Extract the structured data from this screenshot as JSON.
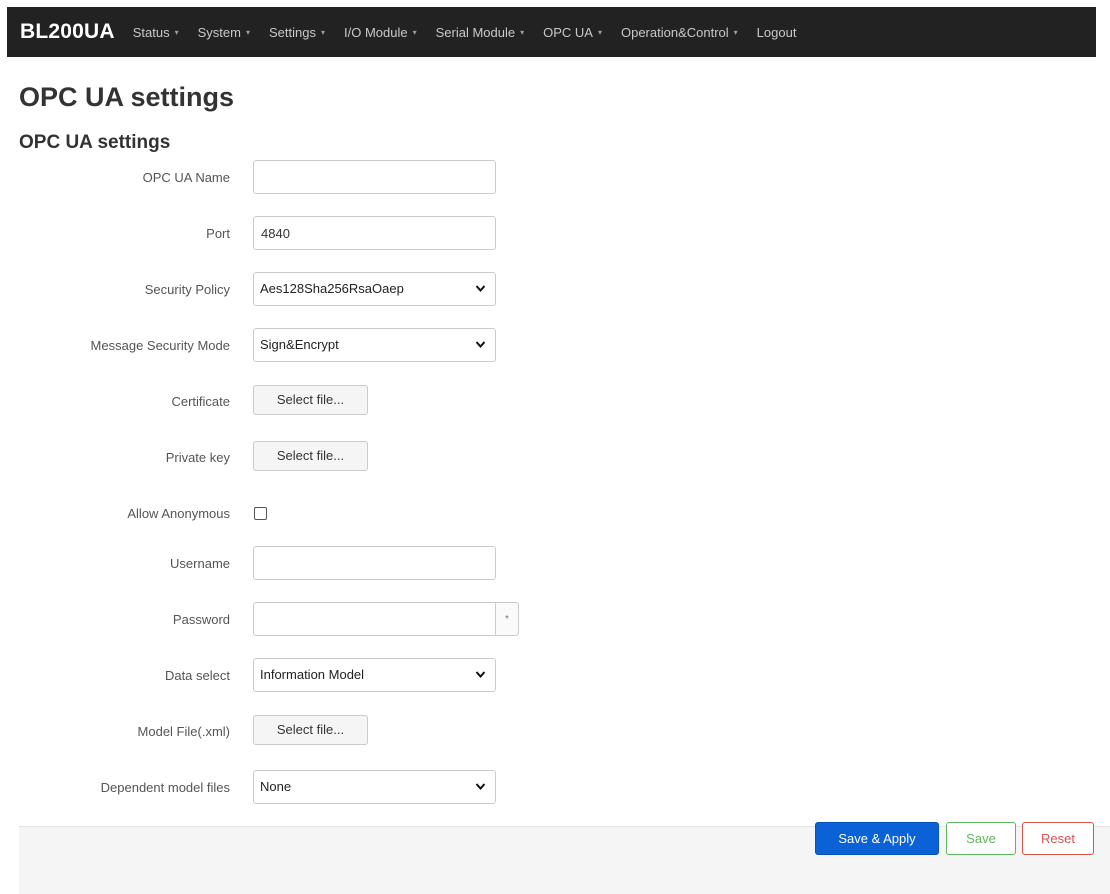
{
  "navbar": {
    "brand": "BL200UA",
    "items": [
      {
        "label": "Status",
        "dropdown": true
      },
      {
        "label": "System",
        "dropdown": true
      },
      {
        "label": "Settings",
        "dropdown": true
      },
      {
        "label": "I/O Module",
        "dropdown": true
      },
      {
        "label": "Serial Module",
        "dropdown": true
      },
      {
        "label": "OPC UA",
        "dropdown": true
      },
      {
        "label": "Operation&Control",
        "dropdown": true
      },
      {
        "label": "Logout",
        "dropdown": false
      }
    ],
    "caret": "▾"
  },
  "page": {
    "title": "OPC UA settings",
    "section_title": "OPC UA settings"
  },
  "form": {
    "opc_ua_name": {
      "label": "OPC UA Name",
      "value": ""
    },
    "port": {
      "label": "Port",
      "value": "4840"
    },
    "security_policy": {
      "label": "Security Policy",
      "value": "Aes128Sha256RsaOaep"
    },
    "message_security_mode": {
      "label": "Message Security Mode",
      "value": "Sign&Encrypt"
    },
    "certificate": {
      "label": "Certificate",
      "button": "Select file..."
    },
    "private_key": {
      "label": "Private key",
      "button": "Select file..."
    },
    "allow_anonymous": {
      "label": "Allow Anonymous",
      "checked": false
    },
    "username": {
      "label": "Username",
      "value": ""
    },
    "password": {
      "label": "Password",
      "value": "",
      "reveal": "*"
    },
    "data_select": {
      "label": "Data select",
      "value": "Information Model"
    },
    "model_file": {
      "label": "Model File(.xml)",
      "button": "Select file..."
    },
    "dependent_model_files": {
      "label": "Dependent model files",
      "value": "None"
    },
    "chevron": "❯"
  },
  "actions": {
    "save_apply": "Save & Apply",
    "save": "Save",
    "reset": "Reset"
  },
  "colors": {
    "navbar_bg": "#222222",
    "primary": "#0a62d6",
    "success": "#5cb85c",
    "danger": "#d9534f"
  }
}
